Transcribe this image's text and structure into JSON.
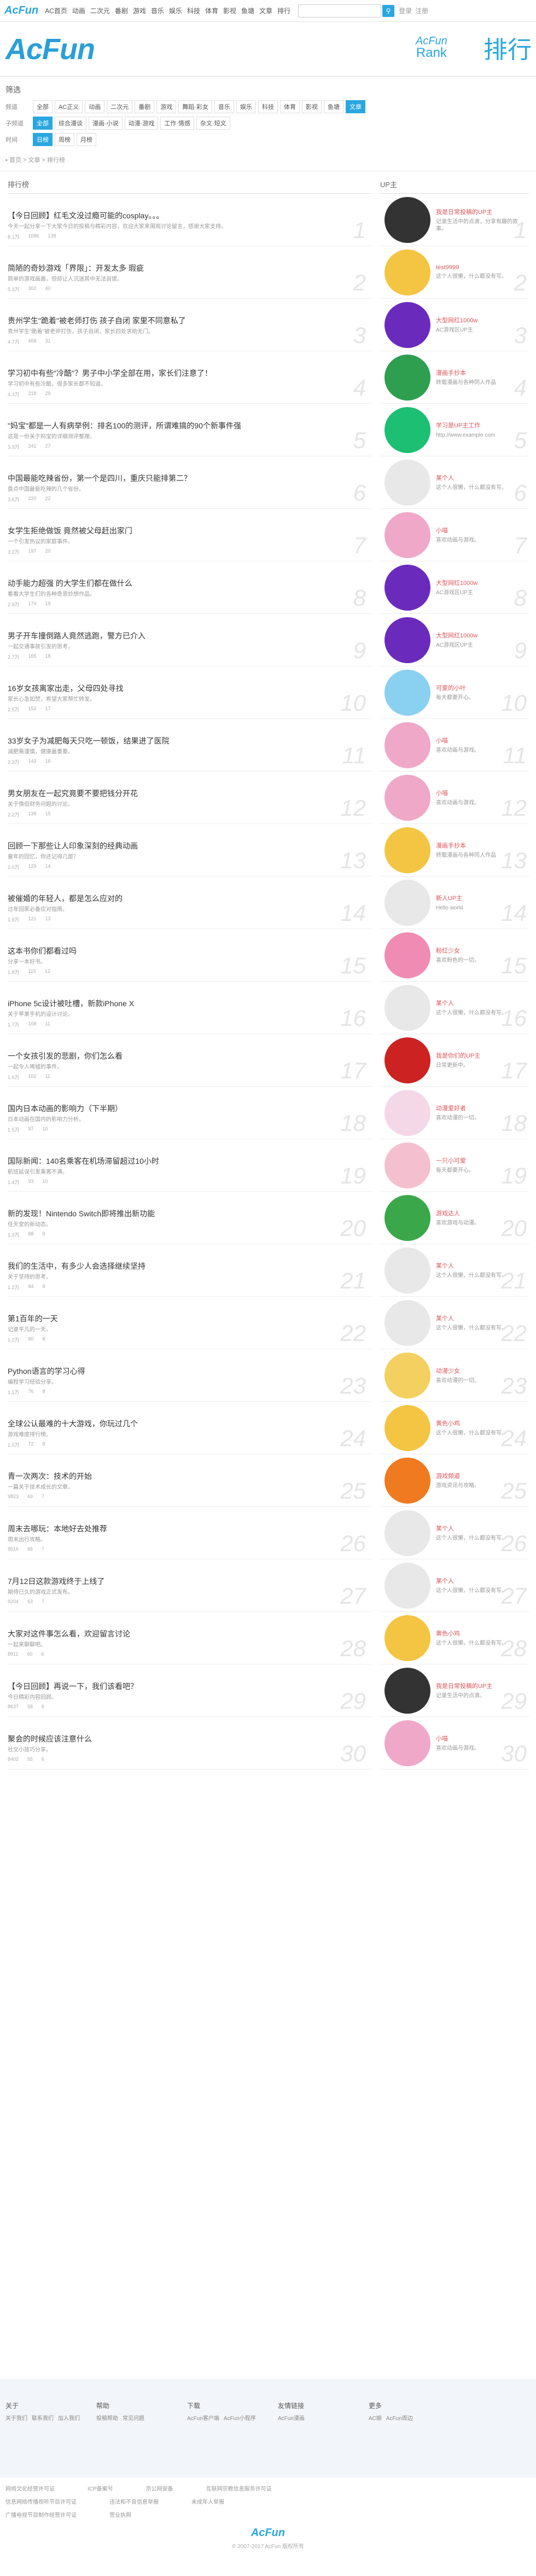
{
  "topnav": {
    "logo": "AcFun",
    "items": [
      "AC首页",
      "动画",
      "二次元",
      "番剧",
      "游戏",
      "音乐",
      "娱乐",
      "科技",
      "体育",
      "影视",
      "鱼塘",
      "文章",
      "排行"
    ],
    "search_placeholder": "",
    "search_icon": "search-icon",
    "right_items": [
      "登录",
      "注册"
    ]
  },
  "header": {
    "logo": "AcFun",
    "rank_en_top": "AcFun",
    "rank_en_bottom": "Rank",
    "rank_cn": "排行"
  },
  "filters": {
    "title": "筛选",
    "rows": [
      {
        "label": "频道",
        "tags": [
          "全部",
          "AC正义",
          "动画",
          "二次元",
          "番剧",
          "游戏",
          "舞蹈·彩女",
          "音乐",
          "娱乐",
          "科技",
          "体育",
          "影视",
          "鱼塘",
          "文章"
        ],
        "active": 13
      },
      {
        "label": "子频道",
        "tags": [
          "全部",
          "综合漫谈",
          "漫画·小说",
          "动漫·游戏",
          "工作·情感",
          "杂文·短文"
        ],
        "active": 0
      },
      {
        "label": "时间",
        "tags": [
          "日榜",
          "周榜",
          "月榜"
        ],
        "active": 0
      }
    ]
  },
  "breadcrumb": "▪ 首页 > 文章 > 排行榜",
  "articles_head": "排行榜",
  "users_head": "UP主",
  "articles": [
    {
      "title": "【今日回顾】红毛文没过瘾可能的cosplay。。。",
      "desc": "今天一起分享一下大家今日的投稿与精彩内容，欢迎大家来围观讨论留言，感谢大家支持。",
      "views": "8.1万",
      "comments": "1086",
      "likes": "138"
    },
    {
      "title": "简陋的奇妙游戏「界限」：开发太多 瑕疵",
      "desc": "简单的游戏画面，但却让人沉迷其中无法自拔。",
      "views": "5.3万",
      "comments": "302",
      "likes": "40"
    },
    {
      "title": "贵州学生\"跪着\"被老师打伤 孩子自闭 家里不同意私了",
      "desc": "贵州学生\"跪着\"被老师打伤，孩子自闭，家长四处求助无门。",
      "views": "4.7万",
      "comments": "468",
      "likes": "31"
    },
    {
      "title": "学习初中有些\"冷酷\"？男子中小学全部在用，家长们注意了！",
      "desc": "学习初中有些冷酷，很多家长都不知道。",
      "views": "4.3万",
      "comments": "218",
      "likes": "29"
    },
    {
      "title": "\"妈宝\"都是一人有病举例：排名100的测评，所谓难搞的90个新事件强",
      "desc": "这是一份关于妈宝的详细测评整理。",
      "views": "3.9万",
      "comments": "241",
      "likes": "27"
    },
    {
      "title": "中国最能吃辣省份，第一个是四川，重庆只能排第二？",
      "desc": "盘点中国最能吃辣的几个省份。",
      "views": "3.6万",
      "comments": "220",
      "likes": "22"
    },
    {
      "title": "女学生拒绝做饭 竟然被父母赶出家门",
      "desc": "一个引发热议的家庭事件。",
      "views": "3.2万",
      "comments": "197",
      "likes": "20"
    },
    {
      "title": "动手能力超强 的大学生们都在做什么",
      "desc": "看看大学生们的各种奇思妙想作品。",
      "views": "2.9万",
      "comments": "174",
      "likes": "19"
    },
    {
      "title": "男子开车撞倒路人竟然逃跑，警方已介入",
      "desc": "一起交通事故引发的思考。",
      "views": "2.7万",
      "comments": "165",
      "likes": "18"
    },
    {
      "title": "16岁女孩离家出走，父母四处寻找",
      "desc": "家长心急如焚，希望大家帮忙转发。",
      "views": "2.5万",
      "comments": "152",
      "likes": "17"
    },
    {
      "title": "33岁女子为减肥每天只吃一顿饭，结果进了医院",
      "desc": "减肥需谨慎，健康最重要。",
      "views": "2.3万",
      "comments": "143",
      "likes": "16"
    },
    {
      "title": "男女朋友在一起究竟要不要把钱分开花",
      "desc": "关于情侣财务问题的讨论。",
      "views": "2.2万",
      "comments": "138",
      "likes": "15"
    },
    {
      "title": "回顾一下那些让人印象深刻的经典动画",
      "desc": "童年的回忆，你还记得几部？",
      "views": "2.0万",
      "comments": "129",
      "likes": "14"
    },
    {
      "title": "被催婚的年轻人，都是怎么应对的",
      "desc": "过年回家必备应对指南。",
      "views": "1.9万",
      "comments": "121",
      "likes": "13"
    },
    {
      "title": "这本书你们都看过吗",
      "desc": "分享一本好书。",
      "views": "1.8万",
      "comments": "115",
      "likes": "12"
    },
    {
      "title": "iPhone 5c设计被吐槽，新款iPhone X",
      "desc": "关于苹果手机的设计讨论。",
      "views": "1.7万",
      "comments": "108",
      "likes": "11"
    },
    {
      "title": "一个女孩引发的悲剧，你们怎么看",
      "desc": "一起令人唏嘘的事件。",
      "views": "1.6万",
      "comments": "102",
      "likes": "11"
    },
    {
      "title": "国内日本动画的影响力（下半期）",
      "desc": "日本动画在国内的影响力分析。",
      "views": "1.5万",
      "comments": "97",
      "likes": "10"
    },
    {
      "title": "国际新闻：140名乘客在机场滞留超过10小时",
      "desc": "航班延误引发乘客不满。",
      "views": "1.4万",
      "comments": "93",
      "likes": "10"
    },
    {
      "title": "新的发现！Nintendo Switch即将推出新功能",
      "desc": "任天堂的新动态。",
      "views": "1.3万",
      "comments": "88",
      "likes": "9"
    },
    {
      "title": "我们的生活中，有多少人会选择继续坚持",
      "desc": "关于坚持的思考。",
      "views": "1.2万",
      "comments": "84",
      "likes": "9"
    },
    {
      "title": "第1百年的一天",
      "desc": "记录平凡的一天。",
      "views": "1.2万",
      "comments": "80",
      "likes": "8"
    },
    {
      "title": "Python语言的学习心得",
      "desc": "编程学习经验分享。",
      "views": "1.1万",
      "comments": "76",
      "likes": "8"
    },
    {
      "title": "全球公认最难的十大游戏，你玩过几个",
      "desc": "游戏难度排行榜。",
      "views": "1.0万",
      "comments": "72",
      "likes": "8"
    },
    {
      "title": "青一次两次：技术的开始",
      "desc": "一篇关于技术成长的文章。",
      "views": "9823",
      "comments": "69",
      "likes": "7"
    },
    {
      "title": "周末去哪玩：本地好去处推荐",
      "desc": "周末出行攻略。",
      "views": "9516",
      "comments": "66",
      "likes": "7"
    },
    {
      "title": "7月12日这款游戏终于上线了",
      "desc": "期待已久的游戏正式发布。",
      "views": "9204",
      "comments": "63",
      "likes": "7"
    },
    {
      "title": "大家对这件事怎么看，欢迎留言讨论",
      "desc": "一起来聊聊吧。",
      "views": "8911",
      "comments": "60",
      "likes": "6"
    },
    {
      "title": "【今日回顾】再说一下，我们该看吧？",
      "desc": "今日精彩内容回顾。",
      "views": "8637",
      "comments": "58",
      "likes": "6"
    },
    {
      "title": "聚会的时候应该注意什么",
      "desc": "社交小技巧分享。",
      "views": "8402",
      "comments": "55",
      "likes": "6"
    }
  ],
  "users": [
    {
      "name": "我是日常投稿的UP主",
      "bio": "记录生活中的点滴，分享有趣的故事。",
      "color": "#333333"
    },
    {
      "name": "test9999",
      "bio": "这个人很懒，什么都没有写。",
      "color": "#f4c542"
    },
    {
      "name": "大型网红1000w",
      "bio": "AC游戏区UP主",
      "color": "#6a2bbd"
    },
    {
      "name": "漫画手抄本",
      "bio": "转载漫画与各种同人作品",
      "color": "#2e9e4f"
    },
    {
      "name": "学习是UP主工作",
      "bio": "http://www.example.com",
      "color": "#1dbf73"
    },
    {
      "name": "某个人",
      "bio": "这个人很懒，什么都没有写。",
      "color": "#e8e8e8"
    },
    {
      "name": "小喵",
      "bio": "喜欢动画与游戏。",
      "color": "#f0a8c8"
    },
    {
      "name": "大型网红1000w",
      "bio": "AC游戏区UP主",
      "color": "#6a2bbd"
    },
    {
      "name": "大型网红1000w",
      "bio": "AC游戏区UP主",
      "color": "#6a2bbd"
    },
    {
      "name": "可爱的小叶",
      "bio": "每天都要开心。",
      "color": "#8ad0f0"
    },
    {
      "name": "小喵",
      "bio": "喜欢动画与游戏。",
      "color": "#f0a8c8"
    },
    {
      "name": "小喵",
      "bio": "喜欢动画与游戏。",
      "color": "#f0a8c8"
    },
    {
      "name": "漫画手抄本",
      "bio": "转载漫画与各种同人作品",
      "color": "#f4c542"
    },
    {
      "name": "新人UP主",
      "bio": "Hello world",
      "color": "#e8e8e8"
    },
    {
      "name": "粉红少女",
      "bio": "喜欢粉色的一切。",
      "color": "#f08cb4"
    },
    {
      "name": "某个人",
      "bio": "这个人很懒，什么都没有写。",
      "color": "#e8e8e8"
    },
    {
      "name": "我是你们的UP主",
      "bio": "日常更新中。",
      "color": "#cc2222"
    },
    {
      "name": "动漫爱好者",
      "bio": "喜欢动漫的一切。",
      "color": "#f4d8e8"
    },
    {
      "name": "一只小可爱",
      "bio": "每天都要开心。",
      "color": "#f4c0d0"
    },
    {
      "name": "游戏达人",
      "bio": "喜欢游戏与动漫。",
      "color": "#3aa84a"
    },
    {
      "name": "某个人",
      "bio": "这个人很懒，什么都没有写。",
      "color": "#e8e8e8"
    },
    {
      "name": "某个人",
      "bio": "这个人很懒，什么都没有写。",
      "color": "#e8e8e8"
    },
    {
      "name": "动漫少女",
      "bio": "喜欢动漫的一切。",
      "color": "#f4d060"
    },
    {
      "name": "黄色小鸡",
      "bio": "这个人很懒，什么都没有写。",
      "color": "#f4c542"
    },
    {
      "name": "游戏频道",
      "bio": "游戏资讯与攻略。",
      "color": "#f07a20"
    },
    {
      "name": "某个人",
      "bio": "这个人很懒，什么都没有写。",
      "color": "#e8e8e8"
    },
    {
      "name": "某个人",
      "bio": "这个人很懒，什么都没有写。",
      "color": "#e8e8e8"
    },
    {
      "name": "黄色小鸡",
      "bio": "这个人很懒，什么都没有写。",
      "color": "#f4c542"
    },
    {
      "name": "我是日常投稿的UP主",
      "bio": "记录生活中的点滴。",
      "color": "#333333"
    },
    {
      "name": "小喵",
      "bio": "喜欢动画与游戏。",
      "color": "#f0a8c8"
    }
  ],
  "footer": {
    "cols": [
      {
        "head": "关于",
        "links": [
          "关于我们",
          "联系我们",
          "加入我们"
        ]
      },
      {
        "head": "帮助",
        "links": [
          "投稿帮助",
          "常见问题"
        ]
      },
      {
        "head": "下载",
        "links": [
          "AcFun客户端",
          "AcFun小程序"
        ]
      },
      {
        "head": "友情链接",
        "links": [
          "AcFun漫画"
        ]
      },
      {
        "head": "更多",
        "links": [
          "AC娘",
          "AcFun周边"
        ]
      }
    ],
    "bottom_rows": [
      [
        "网络文化经营许可证",
        "ICP备案号",
        "京公网安备",
        "互联网宗教信息服务许可证"
      ],
      [
        "信息网络传播视听节目许可证",
        "违法和不良信息举报",
        "未成年人举报"
      ],
      [
        "广播电视节目制作经营许可证",
        "营业执照"
      ]
    ],
    "logo": "AcFun",
    "copyright": "© 2007-2017 AcFun 版权所有"
  },
  "colors": {
    "accent": "#2aa7e0",
    "rank_number": "#e5e5e5"
  }
}
